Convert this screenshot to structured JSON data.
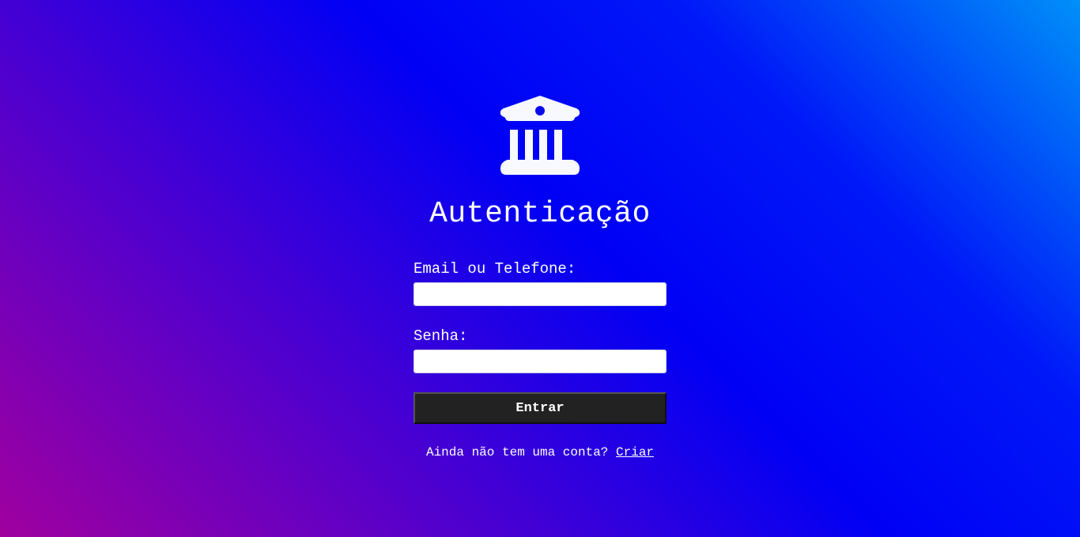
{
  "logo": {
    "icon": "bank-icon",
    "color": "#f7f9ff"
  },
  "login": {
    "title": "Autenticação",
    "email_label": "Email ou Telefone:",
    "email_value": "",
    "password_label": "Senha:",
    "password_value": "",
    "submit_label": "Entrar",
    "signup_prompt": "Ainda não tem uma conta?",
    "signup_link": "Criar"
  },
  "colors": {
    "button_background": "#222222",
    "text": "#ffffff",
    "gradient_start": "#a0009f",
    "gradient_mid": "#0000f5",
    "gradient_end": "#0090f8"
  }
}
